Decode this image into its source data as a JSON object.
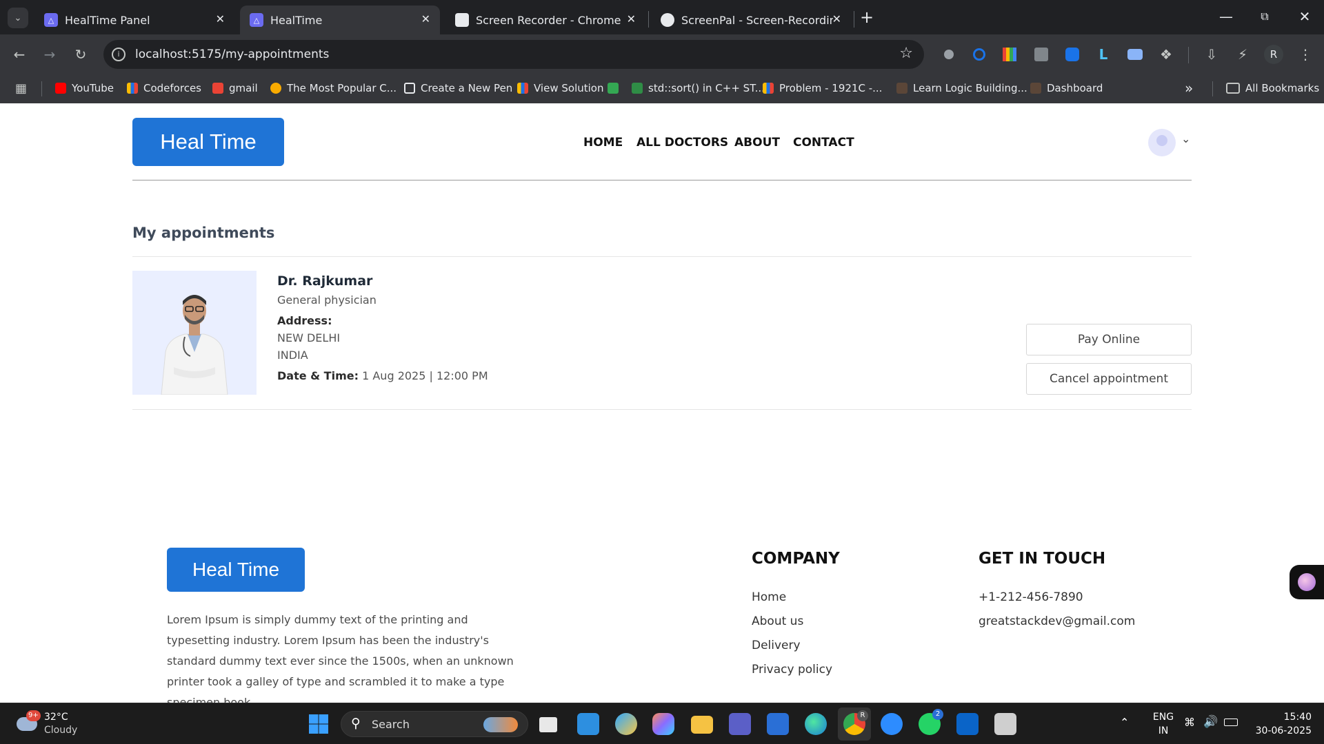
{
  "browser": {
    "tabs": [
      {
        "title": "HealTime Panel",
        "active": false
      },
      {
        "title": "HealTime",
        "active": true
      },
      {
        "title": "Screen Recorder - Chrome Web",
        "active": false
      },
      {
        "title": "ScreenPal - Screen-Recording",
        "active": false
      }
    ],
    "url": "localhost:5175/my-appointments",
    "profile_initial": "R",
    "bookmarks": [
      "YouTube",
      "Codeforces",
      "gmail",
      "The Most Popular C...",
      "Create a New Pen",
      "View Solution",
      "std::sort() in C++ ST...",
      "Problem - 1921C -...",
      "Learn Logic Building...",
      "Dashboard"
    ],
    "all_bookmarks": "All Bookmarks",
    "more_bookmarks": "»"
  },
  "site": {
    "logo": "Heal Time",
    "nav": [
      "HOME",
      "ALL DOCTORS",
      "ABOUT",
      "CONTACT"
    ],
    "page_title": "My appointments",
    "appointment": {
      "doctor_name": "Dr. Rajkumar",
      "speciality": "General physician",
      "address_label": "Address:",
      "address_line1": "NEW DELHI",
      "address_line2": "INDIA",
      "datetime_label": "Date & Time:",
      "datetime_value": "1 Aug 2025 | 12:00 PM",
      "pay_label": "Pay Online",
      "cancel_label": "Cancel appointment"
    },
    "footer": {
      "logo": "Heal Time",
      "description": "Lorem Ipsum is simply dummy text of the printing and typesetting industry. Lorem Ipsum has been the industry's standard dummy text ever since the 1500s, when an unknown printer took a galley of type and scrambled it to make a type specimen book.",
      "company_heading": "COMPANY",
      "company_links": [
        "Home",
        "About us",
        "Delivery",
        "Privacy policy"
      ],
      "contact_heading": "GET IN TOUCH",
      "phone": "+1-212-456-7890",
      "email": "greatstackdev@gmail.com"
    }
  },
  "taskbar": {
    "weather_temp": "32°C",
    "weather_desc": "Cloudy",
    "weather_badge": "9+",
    "search_placeholder": "Search",
    "lang_top": "ENG",
    "lang_bottom": "IN",
    "time": "15:40",
    "date": "30-06-2025",
    "whatsapp_badge": "2",
    "chrome_badge": "R"
  },
  "colors": {
    "brand": "#1f74d6",
    "chrome_dark": "#202124",
    "chrome_toolbar": "#35363a"
  }
}
